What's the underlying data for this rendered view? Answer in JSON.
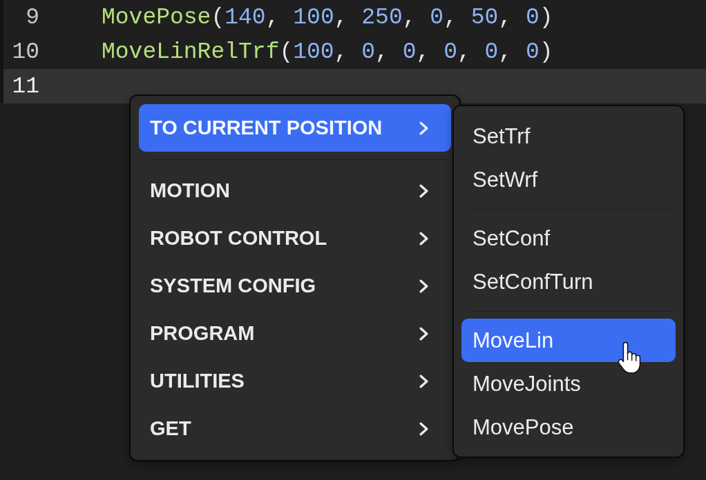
{
  "editor": {
    "lines": [
      {
        "number": "9",
        "current": false,
        "tokens": [
          {
            "kind": "function",
            "text": "MovePose"
          },
          {
            "kind": "punctuation",
            "text": "("
          },
          {
            "kind": "number",
            "text": "140"
          },
          {
            "kind": "punctuation",
            "text": ", "
          },
          {
            "kind": "number",
            "text": "100"
          },
          {
            "kind": "punctuation",
            "text": ", "
          },
          {
            "kind": "number",
            "text": "250"
          },
          {
            "kind": "punctuation",
            "text": ", "
          },
          {
            "kind": "number",
            "text": "0"
          },
          {
            "kind": "punctuation",
            "text": ", "
          },
          {
            "kind": "number",
            "text": "50"
          },
          {
            "kind": "punctuation",
            "text": ", "
          },
          {
            "kind": "number",
            "text": "0"
          },
          {
            "kind": "punctuation",
            "text": ")"
          }
        ]
      },
      {
        "number": "10",
        "current": false,
        "tokens": [
          {
            "kind": "function",
            "text": "MoveLinRelTrf"
          },
          {
            "kind": "punctuation",
            "text": "("
          },
          {
            "kind": "number",
            "text": "100"
          },
          {
            "kind": "punctuation",
            "text": ", "
          },
          {
            "kind": "number",
            "text": "0"
          },
          {
            "kind": "punctuation",
            "text": ", "
          },
          {
            "kind": "number",
            "text": "0"
          },
          {
            "kind": "punctuation",
            "text": ", "
          },
          {
            "kind": "number",
            "text": "0"
          },
          {
            "kind": "punctuation",
            "text": ", "
          },
          {
            "kind": "number",
            "text": "0"
          },
          {
            "kind": "punctuation",
            "text": ", "
          },
          {
            "kind": "number",
            "text": "0"
          },
          {
            "kind": "punctuation",
            "text": ")"
          }
        ]
      },
      {
        "number": "11",
        "current": true
      }
    ]
  },
  "context_menu": {
    "groups": [
      {
        "items": [
          {
            "label": "TO CURRENT POSITION",
            "selected": true
          }
        ]
      },
      {
        "items": [
          {
            "label": "MOTION",
            "selected": false
          },
          {
            "label": "ROBOT CONTROL",
            "selected": false
          },
          {
            "label": "SYSTEM CONFIG",
            "selected": false
          },
          {
            "label": "PROGRAM",
            "selected": false
          },
          {
            "label": "UTILITIES",
            "selected": false
          },
          {
            "label": "GET",
            "selected": false
          }
        ]
      }
    ]
  },
  "submenu": {
    "groups": [
      {
        "items": [
          {
            "label": "SetTrf",
            "selected": false
          },
          {
            "label": "SetWrf",
            "selected": false
          }
        ]
      },
      {
        "items": [
          {
            "label": "SetConf",
            "selected": false
          },
          {
            "label": "SetConfTurn",
            "selected": false
          }
        ]
      },
      {
        "items": [
          {
            "label": "MoveLin",
            "selected": true
          },
          {
            "label": "MoveJoints",
            "selected": false
          },
          {
            "label": "MovePose",
            "selected": false
          }
        ]
      }
    ]
  }
}
